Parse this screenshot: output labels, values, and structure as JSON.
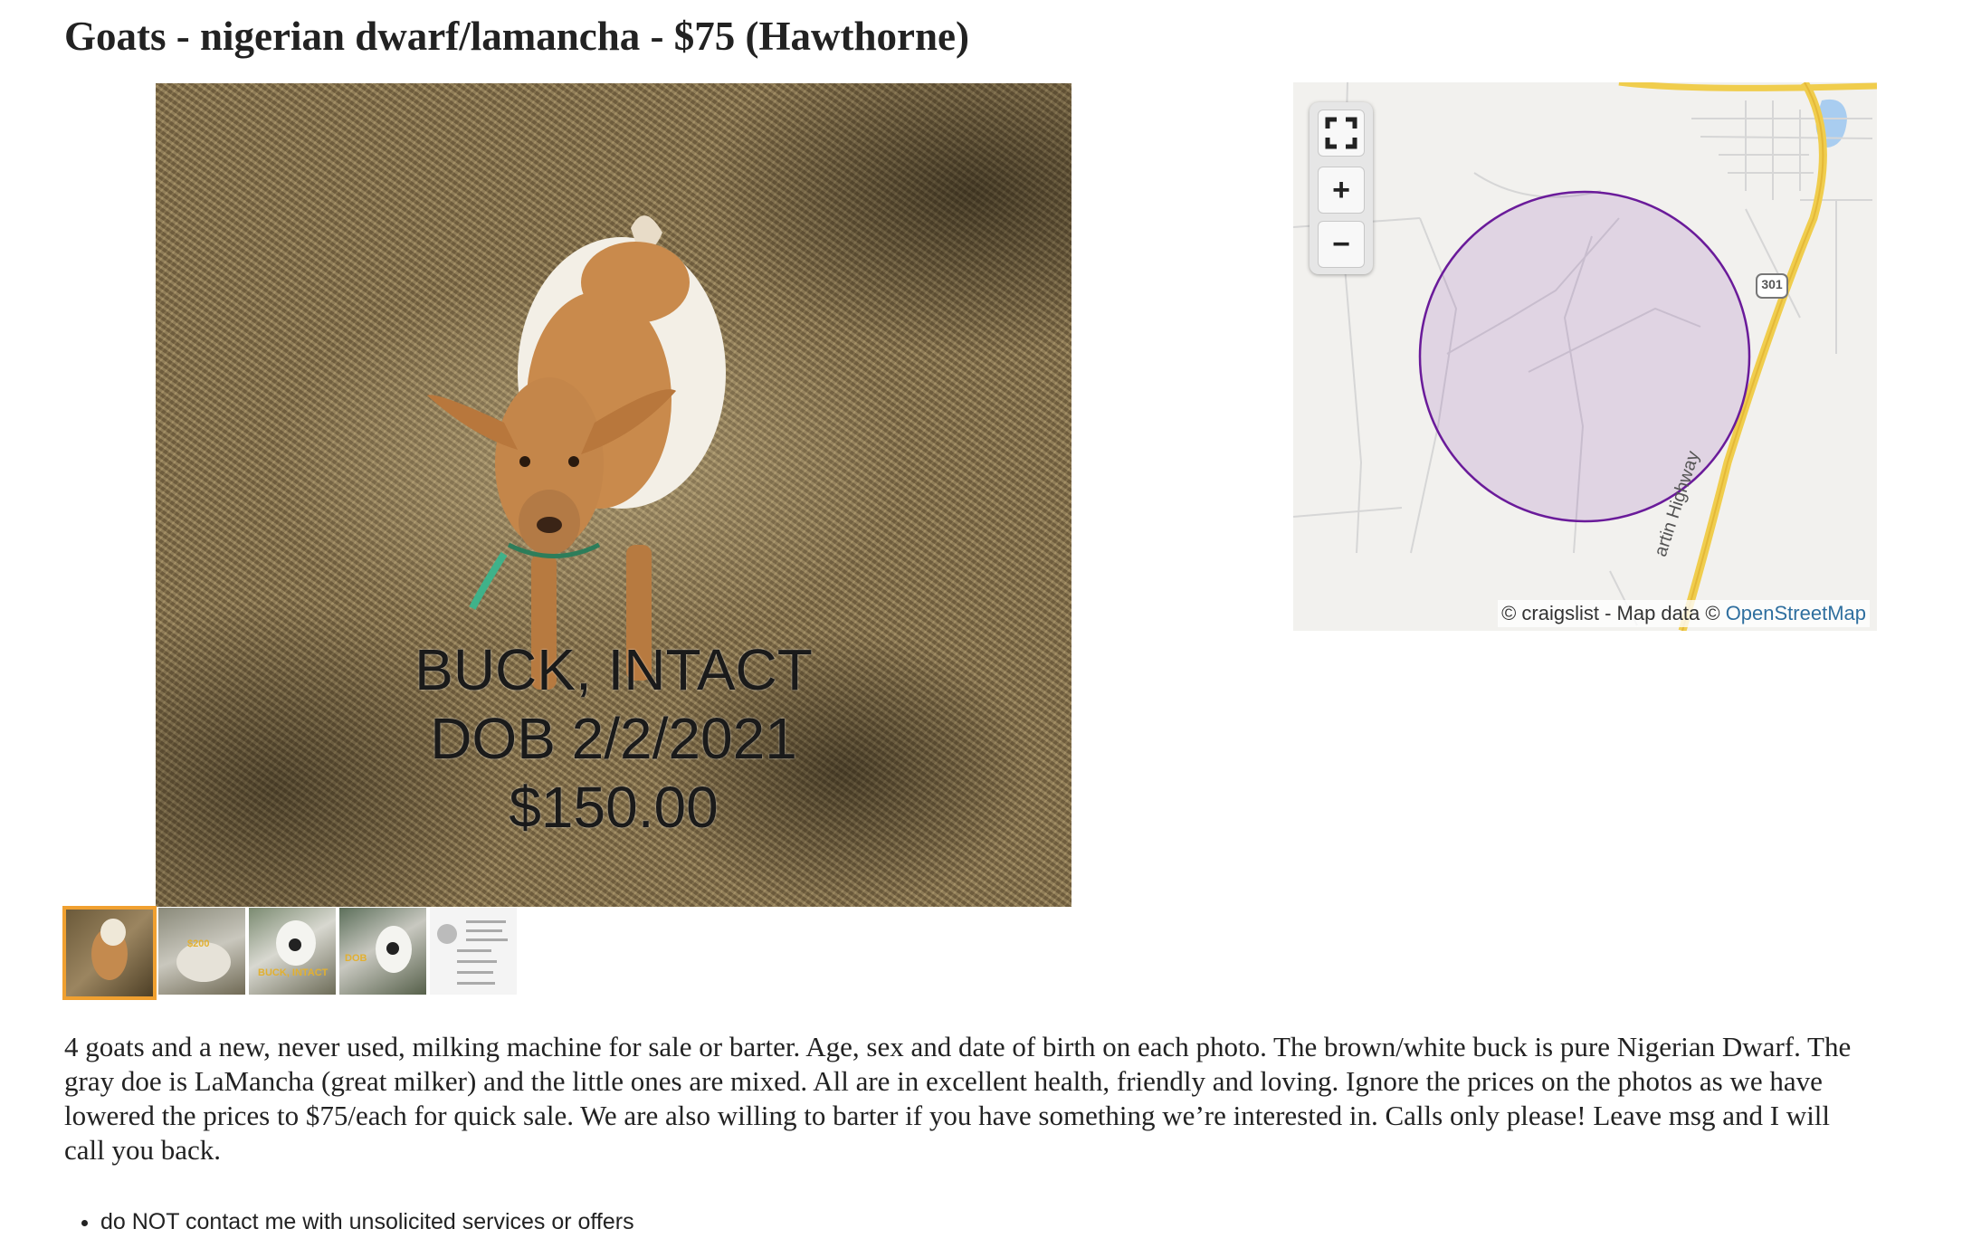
{
  "posting": {
    "title": "Goats - nigerian dwarf/lamancha - $75 (Hawthorne)",
    "body": "4 goats and a new, never used, milking machine for sale or barter. Age, sex and date of birth on each photo. The brown/white buck is pure Nigerian Dwarf. The gray doe is LaMancha (great milker) and the little ones are mixed. All are in excellent health, friendly and loving. Ignore the prices on the photos as we have lowered the prices to $75/each for quick sale. We are also willing to barter if you have something we’re interested in. Calls only please! Leave msg and I will call you back."
  },
  "photo": {
    "caption_line1": "BUCK, INTACT",
    "caption_line2": "DOB 2/2/2021",
    "caption_line3": "$150.00"
  },
  "thumbnails": {
    "count": 5,
    "selected_index": 0,
    "t2_text": "$200",
    "t3_text": "BUCK, INTACT",
    "t4_text": "DOB"
  },
  "map": {
    "controls": {
      "fullscreen_icon": "fullscreen-icon",
      "zoom_in_label": "+",
      "zoom_out_label": "−"
    },
    "highway_label": "artin Highway",
    "route_shield": "301",
    "attribution_prefix": "© craigslist - Map data © ",
    "attribution_link": "OpenStreetMap",
    "circle_color": "#6a1b9a"
  },
  "notices": [
    "do NOT contact me with unsolicited services or offers"
  ]
}
